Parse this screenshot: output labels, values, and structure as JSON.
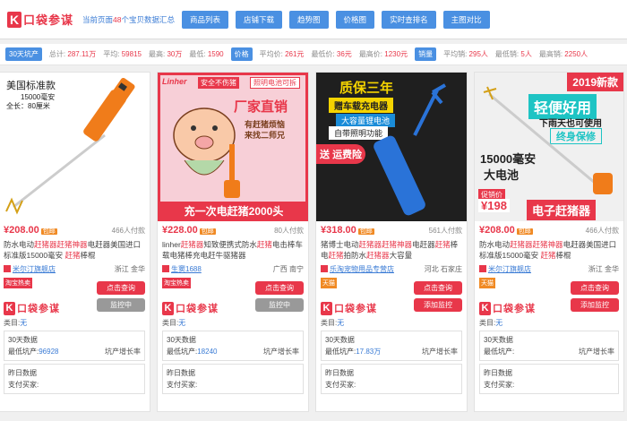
{
  "header": {
    "logo": "口袋参谋",
    "info_prefix": "当前页面",
    "info_count": "48",
    "info_suffix": "个宝贝数据汇总",
    "nav": [
      "商品列表",
      "店铺下载",
      "趋势图",
      "价格图",
      "实时查排名",
      "主图对比"
    ]
  },
  "stats": {
    "tag1": "30天坑产",
    "total_label": "总计:",
    "total": "287.11万",
    "avg_label": "平均:",
    "avg": "59815",
    "max_label": "最高:",
    "max": "30万",
    "min_label": "最低:",
    "min": "1590",
    "tag2": "价格",
    "pavg_label": "平均价:",
    "pavg": "261元",
    "pmin_label": "最低价:",
    "pmin": "36元",
    "pmax_label": "最高价:",
    "pmax": "1230元",
    "tag3": "销量",
    "savg_label": "平均销:",
    "savg": "295人",
    "smin_label": "最低销:",
    "smin": "5人",
    "smax_label": "最高销:",
    "smax": "2250人"
  },
  "common": {
    "query_btn": "点击查询",
    "monitor_btn": "监控中",
    "add_monitor_btn": "添加监控",
    "cat_label": "类目:",
    "cat_val": "无",
    "d30": "30天数据",
    "min_kc": "最低坑产:",
    "kc_growth": "坑产增长率",
    "yesterday": "昨日数据",
    "pay_buyers": "支付买家:",
    "mini_logo": "口袋参谋",
    "hot_tag": "淘宝热卖",
    "tmall_tag": "天猫",
    "price_badge": "包邮"
  },
  "cards": [
    {
      "img_lines": [
        "美国标准款",
        "15000毫安",
        "全长：80厘米"
      ],
      "price": "¥208.00",
      "sold": "466人付款",
      "title": "防水电动赶猪器赶猪神器电赶器美国进口标准版15000毫安 赶猪棒棍",
      "shop": "米尔汀旗舰店",
      "loc": "浙江 金华",
      "min_kc_val": "96928",
      "monitor_state": "monitor"
    },
    {
      "img_lines": [
        "Linher",
        "安全不伤猪",
        "照明电池可拆",
        "厂家直销",
        "有赶猪烦恼",
        "来找二师兄",
        "充一次电赶猪2000头"
      ],
      "price": "¥228.00",
      "sold": "80人付款",
      "title": "linher赶猪器知致便携式防水赶猪电击棒车载电猪棒充电赶牛驱猪器",
      "shop": "生窦1688",
      "loc": "广西 南宁",
      "min_kc_val": "18240",
      "monitor_state": "monitor"
    },
    {
      "img_lines": [
        "质保三年",
        "赠车载充电器",
        "大容量锂电池",
        "自带照明功能",
        "送",
        "运费险"
      ],
      "price": "¥318.00",
      "sold": "561人付款",
      "title": "猪博士电动赶猪器赶猪神器电赶器赶猪棒电赶猪拍防水赶猪器大容量",
      "shop": "乐淘宠物用品专营店",
      "loc": "河北 石家庄",
      "min_kc_val": "17.83万",
      "monitor_state": "add"
    },
    {
      "img_lines": [
        "2019新款",
        "轻便好用",
        "下雨天也可使用",
        "终身保修",
        "15000毫安",
        "大电池",
        "促销价",
        "¥198",
        "电子赶猪器"
      ],
      "price": "¥208.00",
      "sold": "466人付款",
      "title": "防水电动赶猪器赶猪神器电赶器美国进口标准版15000毫安 赶猪棒棍",
      "shop": "米尔汀旗舰店",
      "loc": "浙江 金华",
      "min_kc_val": "",
      "monitor_state": "add"
    }
  ]
}
